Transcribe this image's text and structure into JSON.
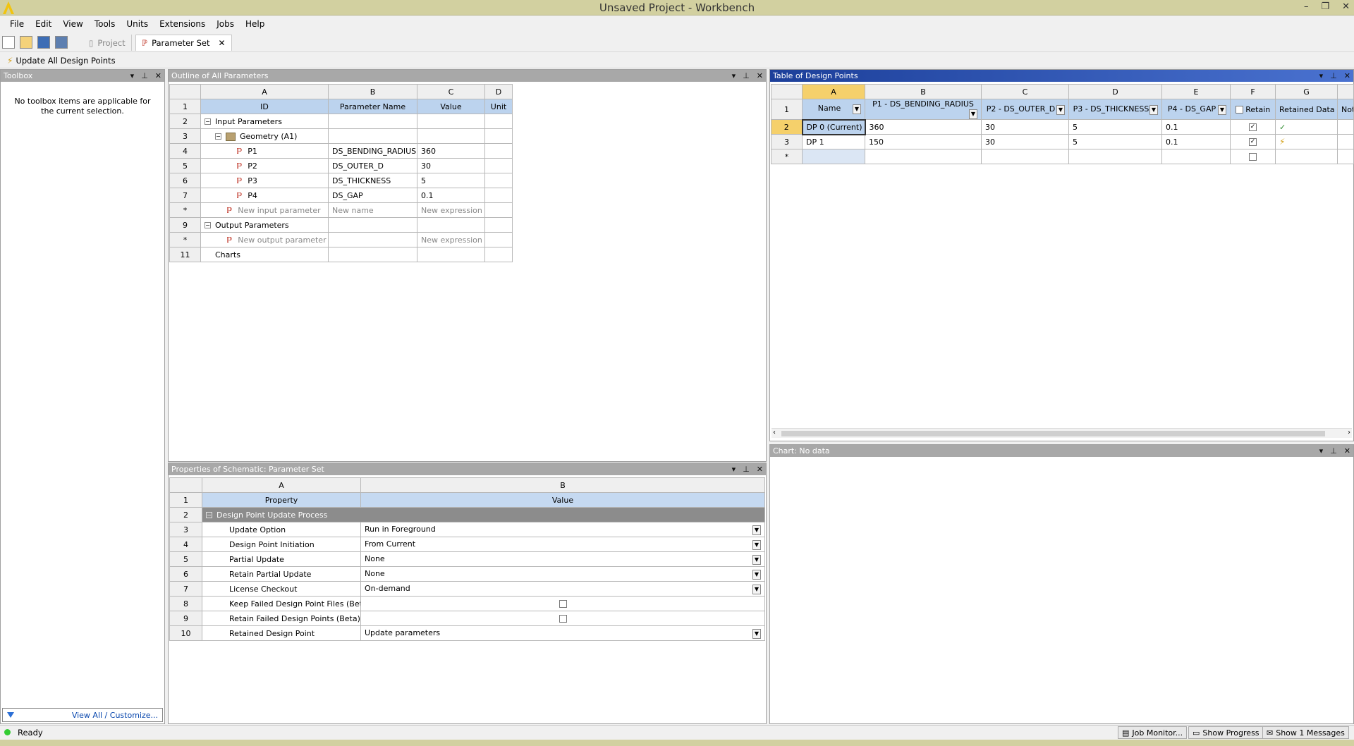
{
  "app": {
    "title": "Unsaved Project - Workbench"
  },
  "menu": [
    "File",
    "Edit",
    "View",
    "Tools",
    "Units",
    "Extensions",
    "Jobs",
    "Help"
  ],
  "tabs": {
    "project": "Project",
    "parameter_set": "Parameter Set"
  },
  "toolbar": {
    "update_all": "Update All Design Points"
  },
  "toolbox": {
    "title": "Toolbox",
    "message": "No toolbox items are applicable for the current selection.",
    "footer_link": "View All / Customize..."
  },
  "outline": {
    "title": "Outline of All Parameters",
    "col_letters": [
      "A",
      "B",
      "C",
      "D"
    ],
    "headers": [
      "ID",
      "Parameter Name",
      "Value",
      "Unit"
    ],
    "rows": [
      {
        "n": "2",
        "id": "Input Parameters",
        "name": "",
        "value": ""
      },
      {
        "n": "3",
        "id": "Geometry (A1)",
        "name": "",
        "value": ""
      },
      {
        "n": "4",
        "id": "P1",
        "name": "DS_BENDING_RADIUS",
        "value": "360"
      },
      {
        "n": "5",
        "id": "P2",
        "name": "DS_OUTER_D",
        "value": "30"
      },
      {
        "n": "6",
        "id": "P3",
        "name": "DS_THICKNESS",
        "value": "5"
      },
      {
        "n": "7",
        "id": "P4",
        "name": "DS_GAP",
        "value": "0.1"
      },
      {
        "n": "*",
        "id": "New input parameter",
        "name": "New name",
        "value": "New expression"
      },
      {
        "n": "9",
        "id": "Output Parameters",
        "name": "",
        "value": ""
      },
      {
        "n": "*",
        "id": "New output parameter",
        "name": "",
        "value": "New expression"
      },
      {
        "n": "11",
        "id": "Charts",
        "name": "",
        "value": ""
      }
    ]
  },
  "design_points": {
    "title": "Table of Design Points",
    "col_letters": [
      "A",
      "B",
      "C",
      "D",
      "E",
      "F",
      "G"
    ],
    "headers": [
      "Name",
      "P1 - DS_BENDING_RADIUS",
      "P2 - DS_OUTER_D",
      "P3 - DS_THICKNESS",
      "P4 - DS_GAP",
      "Retain",
      "Retained Data",
      "Not"
    ],
    "rows": [
      {
        "n": "2",
        "name": "DP 0 (Current)",
        "p1": "360",
        "p2": "30",
        "p3": "5",
        "p4": "0.1",
        "retain": true,
        "data": "check"
      },
      {
        "n": "3",
        "name": "DP 1",
        "p1": "150",
        "p2": "30",
        "p3": "5",
        "p4": "0.1",
        "retain": true,
        "data": "bolt"
      },
      {
        "n": "*",
        "name": "",
        "p1": "",
        "p2": "",
        "p3": "",
        "p4": "",
        "retain": false,
        "data": ""
      }
    ]
  },
  "properties": {
    "title": "Properties of Schematic: Parameter Set",
    "col_letters": [
      "A",
      "B"
    ],
    "headers": [
      "Property",
      "Value"
    ],
    "section": "Design Point Update Process",
    "rows": [
      {
        "n": "3",
        "prop": "Update Option",
        "value": "Run in Foreground",
        "kind": "dropdown"
      },
      {
        "n": "4",
        "prop": "Design Point Initiation",
        "value": "From Current",
        "kind": "dropdown"
      },
      {
        "n": "5",
        "prop": "Partial Update",
        "value": "None",
        "kind": "dropdown"
      },
      {
        "n": "6",
        "prop": "Retain Partial Update",
        "value": "None",
        "kind": "dropdown"
      },
      {
        "n": "7",
        "prop": "License Checkout",
        "value": "On-demand",
        "kind": "dropdown"
      },
      {
        "n": "8",
        "prop": "Keep Failed Design Point Files (Beta)",
        "value": "",
        "kind": "checkbox"
      },
      {
        "n": "9",
        "prop": "Retain Failed Design Points (Beta)",
        "value": "",
        "kind": "checkbox"
      },
      {
        "n": "10",
        "prop": "Retained Design Point",
        "value": "Update parameters",
        "kind": "dropdown"
      }
    ]
  },
  "chart": {
    "title": "Chart: No data"
  },
  "status": {
    "text": "Ready",
    "job_monitor": "Job Monitor...",
    "show_progress": "Show Progress",
    "show_messages": "Show 1 Messages"
  }
}
